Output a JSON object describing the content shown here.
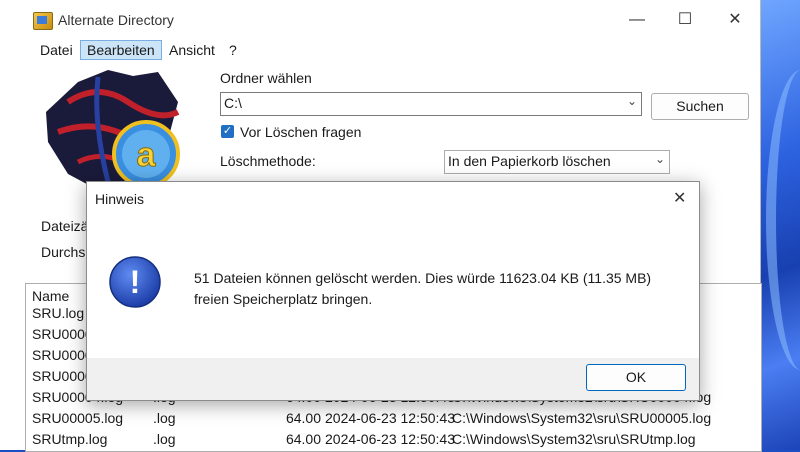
{
  "window": {
    "title": "Alternate Directory",
    "minimize_glyph": "—",
    "maximize_glyph": "☐",
    "close_glyph": "✕"
  },
  "menu": [
    {
      "label": "Datei"
    },
    {
      "label": "Bearbeiten"
    },
    {
      "label": "Ansicht"
    },
    {
      "label": "?"
    }
  ],
  "form": {
    "folder_label": "Ordner wählen",
    "folder_value": "C:\\",
    "search_button": "Suchen",
    "confirm_checked": true,
    "confirm_label": "Vor Löschen fragen",
    "method_label": "Löschmethode:",
    "method_value": "In den Papierkorb löschen",
    "files_count_label": "Dateizä",
    "searched_label": "Durchsu"
  },
  "file_list": {
    "header_name": "Name",
    "rows": [
      {
        "name": "SRU.log",
        "ext": "",
        "size": "",
        "date": "",
        "path": ""
      },
      {
        "name": "SRU00001",
        "ext": "",
        "size": "",
        "date": "",
        "path": ""
      },
      {
        "name": "SRU00002",
        "ext": "",
        "size": "",
        "date": "",
        "path": ""
      },
      {
        "name": "SRU00003",
        "ext": "",
        "size": "",
        "date": "",
        "path": ""
      },
      {
        "name": "SRU00004.log",
        "ext": ".log",
        "size": "64.00",
        "date": "2024-06-23 12:50:43",
        "path": "C:\\Windows\\System32\\sru\\SRU00004.log"
      },
      {
        "name": "SRU00005.log",
        "ext": ".log",
        "size": "64.00",
        "date": "2024-06-23 12:50:43",
        "path": "C:\\Windows\\System32\\sru\\SRU00005.log"
      },
      {
        "name": "SRUtmp.log",
        "ext": ".log",
        "size": "64.00",
        "date": "2024-06-23 12:50:43",
        "path": "C:\\Windows\\System32\\sru\\SRUtmp.log"
      }
    ]
  },
  "dialog": {
    "title": "Hinweis",
    "close_glyph": "✕",
    "message": "51 Dateien können gelöscht werden. Dies würde 11623.04 KB (11.35 MB) freien Speicherplatz bringen.",
    "ok_label": "OK",
    "icon": "information-icon",
    "icon_glyph": "!"
  },
  "colors": {
    "accent": "#0067c0",
    "menu_highlight": "#cce4f7",
    "info_icon": "#2050c8"
  }
}
